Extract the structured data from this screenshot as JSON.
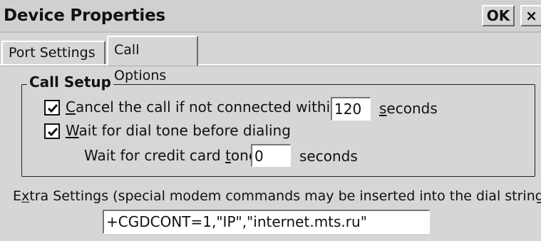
{
  "window": {
    "title": "Device Properties",
    "ok_label": "OK",
    "close_glyph": "×"
  },
  "tabs": [
    {
      "label": "Port Settings",
      "selected": false
    },
    {
      "label": "Call Options",
      "selected": true
    }
  ],
  "call_setup": {
    "group_title": "Call Setup",
    "cancel_call": {
      "checked": true,
      "label_key": "C",
      "label_rest": "ancel the call if not connected within",
      "value": "120",
      "unit_key": "s",
      "unit_rest": "econds"
    },
    "wait_dial_tone": {
      "checked": true,
      "label_key": "W",
      "label_rest": "ait for dial tone before dialing"
    },
    "credit_card": {
      "label_pre": "Wait for credit card ",
      "label_key": "t",
      "label_rest": "one",
      "value": "0",
      "unit": "seconds"
    }
  },
  "extra_settings": {
    "label_pre": "E",
    "label_key": "x",
    "label_rest": "tra Settings (special modem commands may be inserted into the dial string)",
    "value": "+CGDCONT=1,\"IP\",\"internet.mts.ru\""
  }
}
